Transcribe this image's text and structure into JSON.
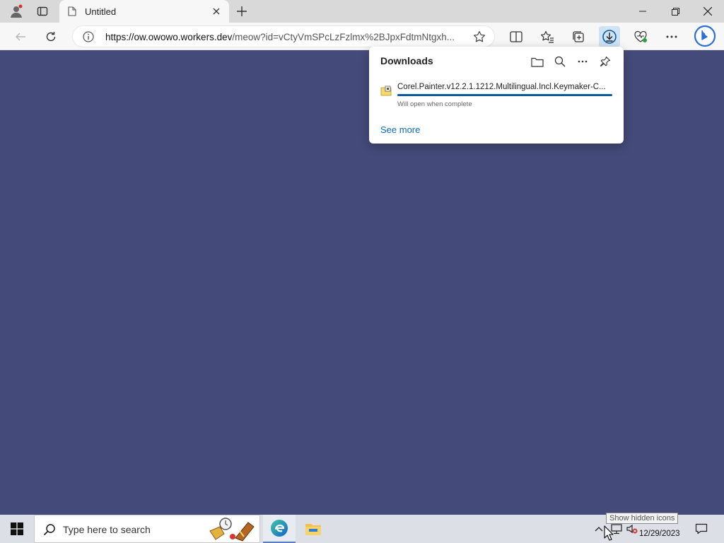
{
  "browser": {
    "tab_title": "Untitled",
    "url_host": "https://ow.owowo.workers.dev",
    "url_path": "/meow?id=vCtyVmSPcLzFzlmx%2BJpxFdtmNtgxh..."
  },
  "downloads": {
    "title": "Downloads",
    "file_name": "Corel.Painter.v12.2.1.1212.Multilingual.Incl.Keymaker-C...",
    "status": "Will open when complete",
    "progress": 1.0,
    "see_more": "See more"
  },
  "taskbar": {
    "search_placeholder": "Type here to search",
    "date": "12/29/2023",
    "tooltip": "Show hidden icons"
  },
  "colors": {
    "page_bg": "#444b7a",
    "accent": "#0c5a9e",
    "link": "#0a6cbd"
  }
}
